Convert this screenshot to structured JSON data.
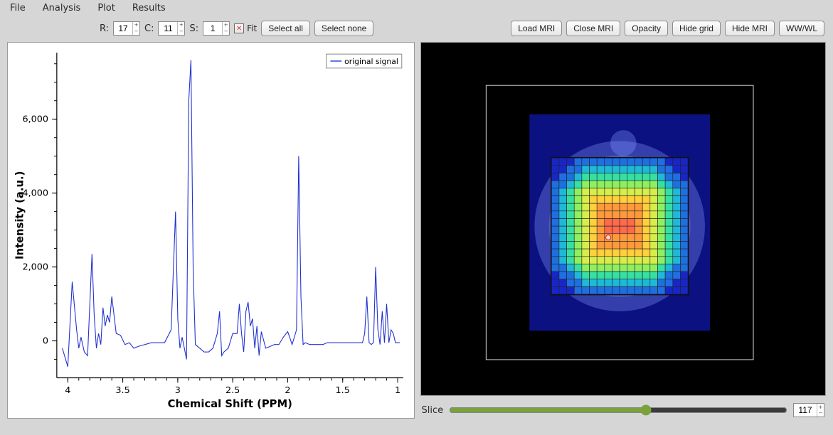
{
  "menu": {
    "file": "File",
    "analysis": "Analysis",
    "plot": "Plot",
    "results": "Results"
  },
  "params": {
    "r_label": "R:",
    "r_value": "17",
    "c_label": "C:",
    "c_value": "11",
    "s_label": "S:",
    "s_value": "1",
    "fit_label": "Fit",
    "select_all": "Select all",
    "select_none": "Select none"
  },
  "mri_buttons": {
    "load": "Load MRI",
    "close": "Close MRI",
    "opacity": "Opacity",
    "hide_grid": "Hide grid",
    "hide_mri": "Hide MRI",
    "wwwl": "WW/WL"
  },
  "slice": {
    "label": "Slice",
    "value": "117"
  },
  "chart": {
    "legend": "original signal",
    "x_title": "Chemical Shift (PPM)",
    "y_title": "Intensity (a.u.)",
    "x_ticks": [
      "4",
      "3.5",
      "3",
      "2.5",
      "2",
      "1.5",
      "1"
    ],
    "y_ticks": [
      "0",
      "2,000",
      "4,000",
      "6,000"
    ]
  },
  "chart_data": {
    "type": "line",
    "title": "",
    "xlabel": "Chemical Shift (PPM)",
    "ylabel": "Intensity (a.u.)",
    "xlim": [
      4.1,
      0.95
    ],
    "ylim": [
      -1000,
      7800
    ],
    "legend": [
      "original signal"
    ],
    "series": [
      {
        "name": "original signal",
        "x": [
          4.05,
          4.0,
          3.96,
          3.92,
          3.9,
          3.88,
          3.85,
          3.82,
          3.78,
          3.76,
          3.74,
          3.72,
          3.7,
          3.68,
          3.66,
          3.64,
          3.62,
          3.6,
          3.56,
          3.52,
          3.48,
          3.44,
          3.4,
          3.36,
          3.3,
          3.24,
          3.18,
          3.12,
          3.06,
          3.02,
          3.0,
          2.98,
          2.96,
          2.94,
          2.92,
          2.9,
          2.88,
          2.86,
          2.84,
          2.8,
          2.76,
          2.72,
          2.68,
          2.64,
          2.62,
          2.6,
          2.58,
          2.54,
          2.5,
          2.46,
          2.44,
          2.42,
          2.4,
          2.38,
          2.36,
          2.34,
          2.32,
          2.3,
          2.28,
          2.26,
          2.24,
          2.2,
          2.16,
          2.12,
          2.08,
          2.04,
          2.0,
          1.96,
          1.92,
          1.9,
          1.88,
          1.86,
          1.84,
          1.8,
          1.76,
          1.72,
          1.68,
          1.64,
          1.6,
          1.56,
          1.52,
          1.48,
          1.44,
          1.4,
          1.36,
          1.32,
          1.3,
          1.28,
          1.26,
          1.24,
          1.22,
          1.2,
          1.18,
          1.16,
          1.14,
          1.12,
          1.1,
          1.08,
          1.06,
          1.04,
          1.02,
          1.0,
          0.98
        ],
        "y": [
          -200,
          -700,
          1600,
          300,
          -200,
          100,
          -300,
          -400,
          2350,
          700,
          -200,
          200,
          -100,
          900,
          400,
          700,
          500,
          1200,
          200,
          150,
          -100,
          -50,
          -200,
          -150,
          -100,
          -50,
          -50,
          -50,
          300,
          3500,
          600,
          -200,
          100,
          -200,
          -500,
          6500,
          7600,
          1900,
          -100,
          -200,
          -300,
          -300,
          -200,
          200,
          800,
          -400,
          -300,
          -200,
          200,
          200,
          1000,
          200,
          -300,
          800,
          1050,
          400,
          600,
          -200,
          400,
          -400,
          250,
          -200,
          -150,
          -100,
          -100,
          100,
          250,
          -100,
          300,
          5000,
          1200,
          -100,
          -50,
          -100,
          -100,
          -100,
          -100,
          -50,
          -50,
          -50,
          -50,
          -50,
          -50,
          -50,
          -50,
          -50,
          200,
          1200,
          -50,
          -100,
          -50,
          2000,
          300,
          -100,
          800,
          -50,
          1000,
          -50,
          300,
          200,
          -50,
          -50,
          -50
        ]
      }
    ]
  },
  "mri": {
    "grid_size": 18,
    "heat_values": [
      [
        0,
        0,
        0,
        1,
        1,
        1,
        1,
        1,
        1,
        1,
        1,
        1,
        1,
        1,
        1,
        0,
        0,
        0
      ],
      [
        0,
        0,
        1,
        1,
        2,
        2,
        2,
        2,
        2,
        2,
        2,
        2,
        2,
        2,
        1,
        1,
        0,
        0
      ],
      [
        0,
        1,
        1,
        2,
        3,
        3,
        3,
        3,
        3,
        3,
        3,
        3,
        3,
        3,
        2,
        1,
        1,
        0
      ],
      [
        1,
        1,
        2,
        3,
        4,
        4,
        4,
        4,
        4,
        4,
        4,
        4,
        4,
        4,
        3,
        2,
        1,
        1
      ],
      [
        1,
        2,
        3,
        4,
        5,
        5,
        5,
        5,
        5,
        5,
        5,
        5,
        5,
        5,
        4,
        3,
        2,
        1
      ],
      [
        1,
        2,
        3,
        4,
        5,
        6,
        6,
        6,
        6,
        6,
        6,
        6,
        6,
        5,
        4,
        3,
        2,
        1
      ],
      [
        1,
        2,
        3,
        4,
        5,
        6,
        7,
        7,
        7,
        7,
        7,
        7,
        6,
        5,
        4,
        3,
        2,
        1
      ],
      [
        1,
        2,
        3,
        4,
        5,
        6,
        7,
        7,
        7,
        7,
        7,
        7,
        6,
        5,
        4,
        3,
        2,
        1
      ],
      [
        1,
        2,
        3,
        4,
        5,
        6,
        7,
        8,
        8,
        8,
        8,
        7,
        6,
        5,
        4,
        3,
        2,
        1
      ],
      [
        1,
        2,
        3,
        4,
        5,
        6,
        7,
        8,
        8,
        8,
        8,
        7,
        6,
        5,
        4,
        3,
        2,
        1
      ],
      [
        1,
        2,
        3,
        4,
        5,
        6,
        7,
        7,
        7,
        7,
        7,
        7,
        6,
        5,
        4,
        3,
        2,
        1
      ],
      [
        1,
        2,
        3,
        4,
        5,
        6,
        7,
        7,
        7,
        7,
        7,
        7,
        6,
        5,
        4,
        3,
        2,
        1
      ],
      [
        1,
        2,
        3,
        4,
        5,
        6,
        6,
        6,
        6,
        6,
        6,
        6,
        6,
        5,
        4,
        3,
        2,
        1
      ],
      [
        1,
        2,
        3,
        4,
        5,
        5,
        5,
        5,
        5,
        5,
        5,
        5,
        5,
        5,
        4,
        3,
        2,
        1
      ],
      [
        1,
        1,
        2,
        3,
        4,
        4,
        4,
        4,
        4,
        4,
        4,
        4,
        4,
        4,
        3,
        2,
        1,
        1
      ],
      [
        0,
        1,
        1,
        2,
        3,
        3,
        3,
        3,
        3,
        3,
        3,
        3,
        3,
        3,
        2,
        1,
        1,
        0
      ],
      [
        0,
        0,
        1,
        1,
        2,
        2,
        2,
        2,
        2,
        2,
        2,
        2,
        2,
        2,
        1,
        1,
        0,
        0
      ],
      [
        0,
        0,
        0,
        1,
        1,
        1,
        1,
        1,
        1,
        1,
        1,
        1,
        1,
        1,
        1,
        0,
        0,
        0
      ]
    ],
    "heat_palette": [
      "#1826c8",
      "#1e6fe0",
      "#1fb8d8",
      "#36e0a3",
      "#8ef060",
      "#d7ed4a",
      "#ffcf3c",
      "#ff9a3c",
      "#ff6a4a"
    ]
  }
}
